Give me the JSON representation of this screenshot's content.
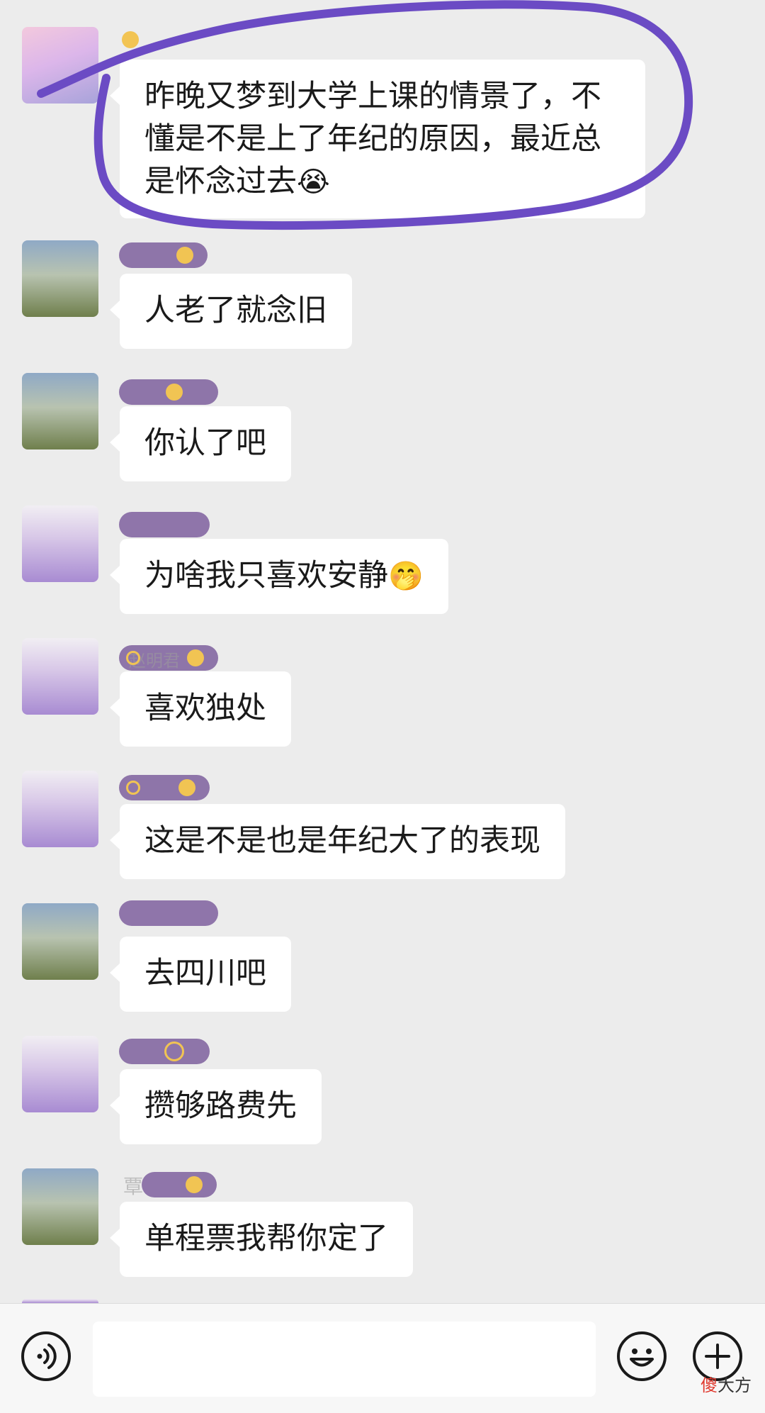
{
  "messages": [
    {
      "avatar": "pink-avatar",
      "name": "",
      "text": "昨晚又梦到大学上课的情景了，不懂是不是上了年纪的原因，最近总是怀念过去",
      "emoji": "😭"
    },
    {
      "avatar": "people-avatar",
      "name": "",
      "text": "人老了就念旧",
      "emoji": ""
    },
    {
      "avatar": "people-avatar",
      "name": "",
      "text": "你认了吧",
      "emoji": ""
    },
    {
      "avatar": "lavender-avatar",
      "name": "",
      "text": "为啥我只喜欢安静",
      "emoji": "🤭"
    },
    {
      "avatar": "lavender-avatar",
      "name": "赵明君",
      "text": "喜欢独处",
      "emoji": ""
    },
    {
      "avatar": "lavender-avatar",
      "name": "",
      "text": "这是不是也是年纪大了的表现",
      "emoji": ""
    },
    {
      "avatar": "people-avatar",
      "name": "",
      "text": "去四川吧",
      "emoji": ""
    },
    {
      "avatar": "lavender-avatar",
      "name": "",
      "text": "攒够路费先",
      "emoji": ""
    },
    {
      "avatar": "people-avatar",
      "name": "覃",
      "text": "单程票我帮你定了",
      "emoji": ""
    }
  ],
  "input_bar": {
    "placeholder": "",
    "voice_icon": "voice-icon",
    "emoji_icon": "emoji-icon",
    "plus_icon": "plus-icon"
  },
  "watermark": {
    "accent": "傻",
    "rest": "大方"
  },
  "colors": {
    "background": "#ececec",
    "bubble": "#ffffff",
    "highlight": "#6b4bc4",
    "name_redaction": "#8a6fa6"
  }
}
